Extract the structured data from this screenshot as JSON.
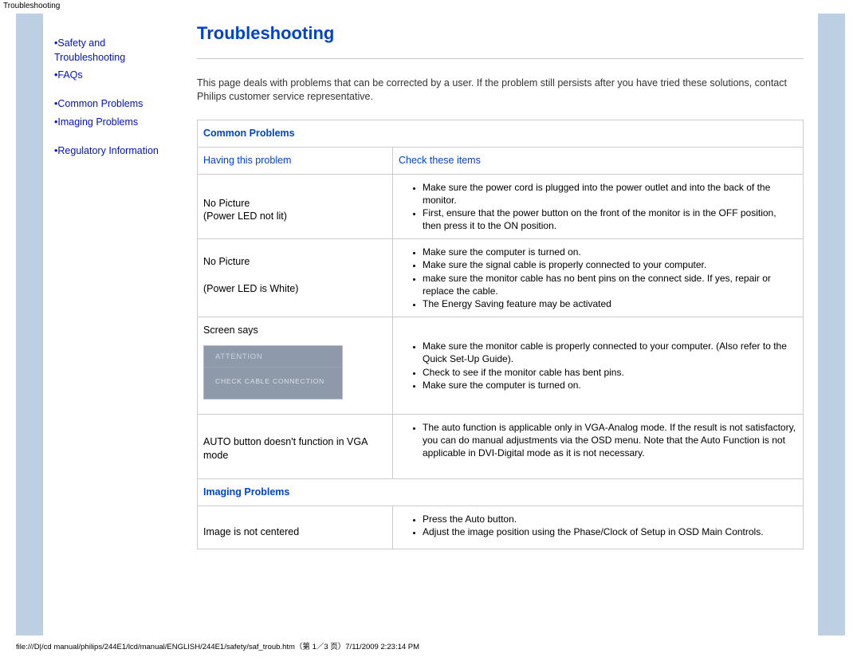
{
  "top_label": "Troubleshooting",
  "page_title": "Troubleshooting",
  "sidebar": {
    "items": [
      {
        "bullet": "•",
        "label": "Safety and Troubleshooting"
      },
      {
        "bullet": "•",
        "label": "FAQs"
      },
      {
        "bullet": "•",
        "label": "Common Problems"
      },
      {
        "bullet": "•",
        "label": "Imaging Problems"
      },
      {
        "bullet": "•",
        "label": "Regulatory Information"
      }
    ]
  },
  "intro": "This page deals with problems that can be corrected by a user. If the problem still persists after you have tried these solutions, contact Philips customer service representative.",
  "sections": {
    "common_problems": "Common Problems",
    "imaging_problems": "Imaging Problems"
  },
  "columns": {
    "problem": "Having this problem",
    "check": "Check these items"
  },
  "rows": {
    "r1": {
      "problem_line1": "No Picture",
      "problem_line2": "(Power LED not lit)",
      "checks": [
        "Make sure the power cord is plugged into the power outlet and into the back of the monitor.",
        "First, ensure that the power button on the front of the monitor is in the OFF position, then press it to the ON position."
      ]
    },
    "r2": {
      "problem_line1": "No Picture",
      "problem_line2": "(Power LED is White)",
      "checks": [
        "Make sure the computer is turned on.",
        "Make sure the signal cable is properly connected to your computer.",
        "make sure the monitor cable has no bent pins on the connect side. If yes, repair or replace the cable.",
        "The Energy Saving feature may be activated"
      ]
    },
    "r3": {
      "problem": "Screen says",
      "attn_title": "ATTENTION",
      "attn_body": "CHECK CABLE CONNECTION",
      "checks": [
        "Make sure the monitor cable is properly connected to your computer. (Also refer to the Quick Set-Up Guide).",
        "Check to see if the monitor cable has bent pins.",
        "Make sure the computer is turned on."
      ]
    },
    "r4": {
      "problem": "AUTO button doesn't function in VGA mode",
      "checks": [
        "The auto function is applicable only in VGA-Analog mode.  If the result is not satisfactory, you can do manual adjustments via the OSD menu.  Note that the Auto Function is not applicable in DVI-Digital mode as it is not necessary."
      ]
    },
    "r5": {
      "problem": "Image is not centered",
      "checks": [
        "Press the Auto button.",
        "Adjust the image position using the Phase/Clock of Setup in OSD Main Controls."
      ]
    }
  },
  "footer_path": "file:///D|/cd manual/philips/244E1/lcd/manual/ENGLISH/244E1/safety/saf_troub.htm（第 1／3 页）7/11/2009 2:23:14 PM"
}
